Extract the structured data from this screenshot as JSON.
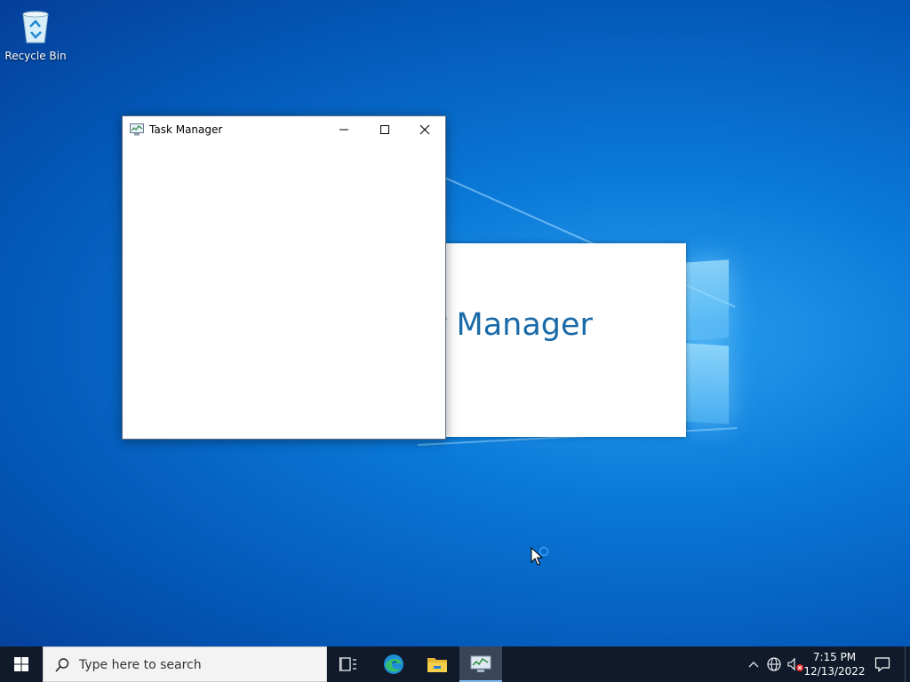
{
  "desktop": {
    "recycle_bin_label": "Recycle Bin"
  },
  "splash": {
    "partial_title": "r Manager"
  },
  "task_manager": {
    "title": "Task Manager"
  },
  "taskbar": {
    "search_placeholder": "Type here to search",
    "time": "7:15 PM",
    "date": "12/13/2022"
  },
  "colors": {
    "accent": "#0a78d7",
    "taskbar": "#101a2a",
    "splash_text": "#1a6aa8"
  },
  "icons": {
    "start": "windows-logo-icon",
    "search": "search-icon",
    "task_view": "task-view-icon",
    "edge": "edge-icon",
    "explorer": "file-explorer-icon",
    "task_manager": "task-manager-icon",
    "chevron": "chevron-up-icon",
    "network": "network-globe-icon",
    "volume": "volume-muted-icon",
    "notifications": "action-center-icon"
  }
}
